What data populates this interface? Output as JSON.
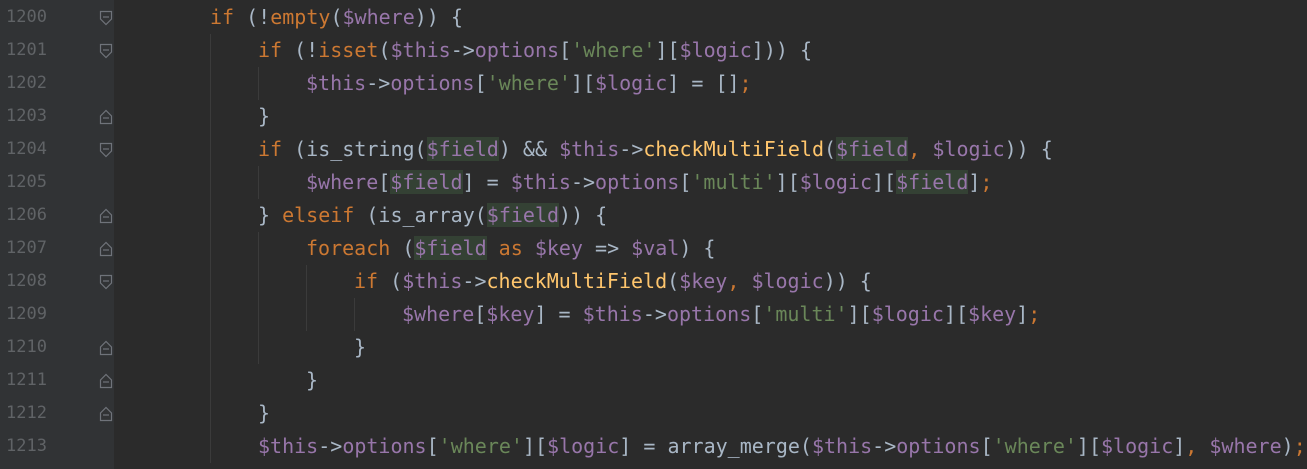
{
  "editor": {
    "language": "php",
    "colors": {
      "background": "#2b2b2b",
      "gutter": "#313335",
      "line_number": "#606366",
      "keyword": "#cc7832",
      "function": "#ffc66d",
      "variable": "#9876aa",
      "string": "#6a8759",
      "plain": "#a9b7c6",
      "usage_highlight": "#344134"
    },
    "lines": [
      {
        "number": "1200",
        "fold": "open",
        "tokens": [
          {
            "t": "kw",
            "v": "if"
          },
          {
            "t": "pl",
            "v": " (!"
          },
          {
            "t": "kw",
            "v": "empty"
          },
          {
            "t": "pl",
            "v": "("
          },
          {
            "t": "var",
            "v": "$where"
          },
          {
            "t": "pl",
            "v": ")) {"
          }
        ]
      },
      {
        "number": "1201",
        "fold": "open",
        "tokens": [
          {
            "t": "kw",
            "v": "if"
          },
          {
            "t": "pl",
            "v": " (!"
          },
          {
            "t": "kw",
            "v": "isset"
          },
          {
            "t": "pl",
            "v": "("
          },
          {
            "t": "var",
            "v": "$this"
          },
          {
            "t": "pl",
            "v": "->"
          },
          {
            "t": "var",
            "v": "options"
          },
          {
            "t": "pl",
            "v": "["
          },
          {
            "t": "str",
            "v": "'where'"
          },
          {
            "t": "pl",
            "v": "]["
          },
          {
            "t": "var",
            "v": "$logic"
          },
          {
            "t": "pl",
            "v": "])) {"
          }
        ]
      },
      {
        "number": "1202",
        "fold": "none",
        "tokens": [
          {
            "t": "var",
            "v": "$this"
          },
          {
            "t": "pl",
            "v": "->"
          },
          {
            "t": "var",
            "v": "options"
          },
          {
            "t": "pl",
            "v": "["
          },
          {
            "t": "str",
            "v": "'where'"
          },
          {
            "t": "pl",
            "v": "]["
          },
          {
            "t": "var",
            "v": "$logic"
          },
          {
            "t": "pl",
            "v": "] = []"
          },
          {
            "t": "kw",
            "v": ";"
          }
        ]
      },
      {
        "number": "1203",
        "fold": "close",
        "tokens": [
          {
            "t": "pl",
            "v": "}"
          }
        ]
      },
      {
        "number": "1204",
        "fold": "open",
        "tokens": [
          {
            "t": "kw",
            "v": "if"
          },
          {
            "t": "pl",
            "v": " (is_string("
          },
          {
            "t": "var hl",
            "v": "$field"
          },
          {
            "t": "pl",
            "v": ") && "
          },
          {
            "t": "var",
            "v": "$this"
          },
          {
            "t": "pl",
            "v": "->"
          },
          {
            "t": "fn",
            "v": "checkMultiField"
          },
          {
            "t": "pl",
            "v": "("
          },
          {
            "t": "var hl",
            "v": "$field"
          },
          {
            "t": "kw",
            "v": ", "
          },
          {
            "t": "var",
            "v": "$logic"
          },
          {
            "t": "pl",
            "v": ")) {"
          }
        ]
      },
      {
        "number": "1205",
        "fold": "none",
        "tokens": [
          {
            "t": "var",
            "v": "$where"
          },
          {
            "t": "pl",
            "v": "["
          },
          {
            "t": "var hl",
            "v": "$field"
          },
          {
            "t": "pl",
            "v": "] = "
          },
          {
            "t": "var",
            "v": "$this"
          },
          {
            "t": "pl",
            "v": "->"
          },
          {
            "t": "var",
            "v": "options"
          },
          {
            "t": "pl",
            "v": "["
          },
          {
            "t": "str",
            "v": "'multi'"
          },
          {
            "t": "pl",
            "v": "]["
          },
          {
            "t": "var",
            "v": "$logic"
          },
          {
            "t": "pl",
            "v": "]["
          },
          {
            "t": "var hl",
            "v": "$field"
          },
          {
            "t": "pl",
            "v": "]"
          },
          {
            "t": "kw",
            "v": ";"
          }
        ]
      },
      {
        "number": "1206",
        "fold": "close",
        "tokens": [
          {
            "t": "pl",
            "v": "} "
          },
          {
            "t": "kw",
            "v": "elseif"
          },
          {
            "t": "pl",
            "v": " (is_array("
          },
          {
            "t": "var hl",
            "v": "$field"
          },
          {
            "t": "pl",
            "v": ")) {"
          }
        ]
      },
      {
        "number": "1207",
        "fold": "close",
        "tokens": [
          {
            "t": "kw",
            "v": "foreach"
          },
          {
            "t": "pl",
            "v": " ("
          },
          {
            "t": "var hl",
            "v": "$field"
          },
          {
            "t": "kw",
            "v": " as "
          },
          {
            "t": "var",
            "v": "$key"
          },
          {
            "t": "pl",
            "v": " => "
          },
          {
            "t": "var",
            "v": "$val"
          },
          {
            "t": "pl",
            "v": ") {"
          }
        ]
      },
      {
        "number": "1208",
        "fold": "open",
        "tokens": [
          {
            "t": "kw",
            "v": "if"
          },
          {
            "t": "pl",
            "v": " ("
          },
          {
            "t": "var",
            "v": "$this"
          },
          {
            "t": "pl",
            "v": "->"
          },
          {
            "t": "fn",
            "v": "checkMultiField"
          },
          {
            "t": "pl",
            "v": "("
          },
          {
            "t": "var",
            "v": "$key"
          },
          {
            "t": "kw",
            "v": ", "
          },
          {
            "t": "var",
            "v": "$logic"
          },
          {
            "t": "pl",
            "v": ")) {"
          }
        ]
      },
      {
        "number": "1209",
        "fold": "none",
        "tokens": [
          {
            "t": "var",
            "v": "$where"
          },
          {
            "t": "pl",
            "v": "["
          },
          {
            "t": "var",
            "v": "$key"
          },
          {
            "t": "pl",
            "v": "] = "
          },
          {
            "t": "var",
            "v": "$this"
          },
          {
            "t": "pl",
            "v": "->"
          },
          {
            "t": "var",
            "v": "options"
          },
          {
            "t": "pl",
            "v": "["
          },
          {
            "t": "str",
            "v": "'multi'"
          },
          {
            "t": "pl",
            "v": "]["
          },
          {
            "t": "var",
            "v": "$logic"
          },
          {
            "t": "pl",
            "v": "]["
          },
          {
            "t": "var",
            "v": "$key"
          },
          {
            "t": "pl",
            "v": "]"
          },
          {
            "t": "kw",
            "v": ";"
          }
        ]
      },
      {
        "number": "1210",
        "fold": "close",
        "tokens": [
          {
            "t": "pl",
            "v": "}"
          }
        ]
      },
      {
        "number": "1211",
        "fold": "close",
        "tokens": [
          {
            "t": "pl",
            "v": "}"
          }
        ]
      },
      {
        "number": "1212",
        "fold": "close",
        "tokens": [
          {
            "t": "pl",
            "v": "}"
          }
        ]
      },
      {
        "number": "1213",
        "fold": "none",
        "tokens": [
          {
            "t": "var",
            "v": "$this"
          },
          {
            "t": "pl",
            "v": "->"
          },
          {
            "t": "var",
            "v": "options"
          },
          {
            "t": "pl",
            "v": "["
          },
          {
            "t": "str",
            "v": "'where'"
          },
          {
            "t": "pl",
            "v": "]["
          },
          {
            "t": "var",
            "v": "$logic"
          },
          {
            "t": "pl",
            "v": "] = array_merge("
          },
          {
            "t": "var",
            "v": "$this"
          },
          {
            "t": "pl",
            "v": "->"
          },
          {
            "t": "var",
            "v": "options"
          },
          {
            "t": "pl",
            "v": "["
          },
          {
            "t": "str",
            "v": "'where'"
          },
          {
            "t": "pl",
            "v": "]["
          },
          {
            "t": "var",
            "v": "$logic"
          },
          {
            "t": "pl",
            "v": "]"
          },
          {
            "t": "kw",
            "v": ", "
          },
          {
            "t": "var",
            "v": "$where"
          },
          {
            "t": "pl",
            "v": ")"
          },
          {
            "t": "kw",
            "v": ";"
          }
        ]
      }
    ]
  }
}
